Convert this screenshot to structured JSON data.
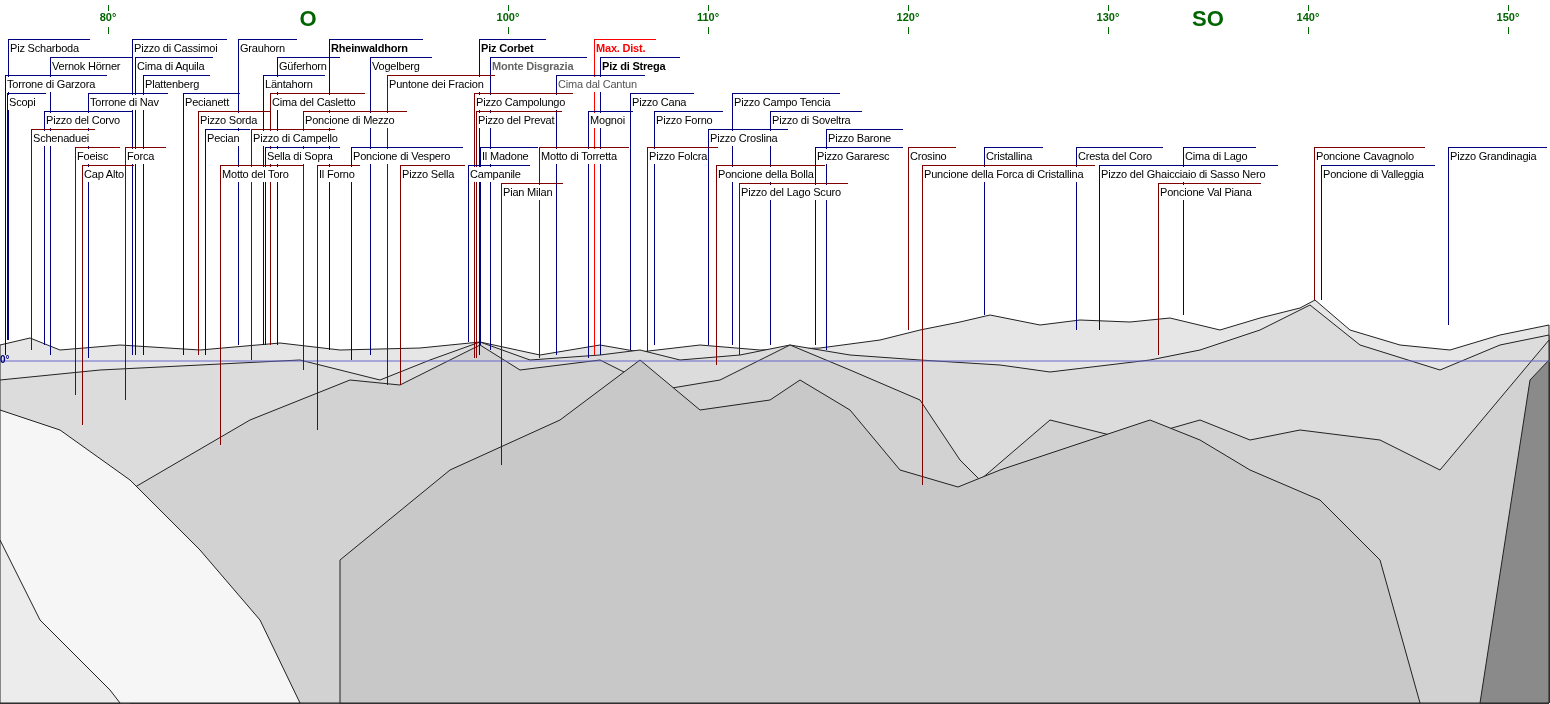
{
  "compass": [
    {
      "text": "80°",
      "kind": "degree"
    },
    {
      "text": "O",
      "kind": "cardinal"
    },
    {
      "text": "100°",
      "kind": "degree"
    },
    {
      "text": "110°",
      "kind": "degree"
    },
    {
      "text": "120°",
      "kind": "degree"
    },
    {
      "text": "130°",
      "kind": "degree"
    },
    {
      "text": "SO",
      "kind": "cardinal"
    },
    {
      "text": "140°",
      "kind": "degree"
    },
    {
      "text": "150°",
      "kind": "degree"
    }
  ],
  "horizon": {
    "label": "0°"
  },
  "labels": [
    {
      "text": "Piz Scharboda",
      "kind": "normal",
      "color": "#000080"
    },
    {
      "text": "Pizzo di Cassimoi",
      "kind": "normal",
      "color": "#000080"
    },
    {
      "text": "Grauhorn",
      "kind": "normal",
      "color": "#000080"
    },
    {
      "text": "Rheinwaldhorn",
      "kind": "bold",
      "color": "#000080"
    },
    {
      "text": "Piz Corbet",
      "kind": "bold",
      "color": "#000080"
    },
    {
      "text": "Max. Dist.",
      "kind": "max",
      "color": "#ff0000"
    },
    {
      "text": "Vernok Hörner",
      "kind": "normal",
      "color": "#000080"
    },
    {
      "text": "Cima di Aquila",
      "kind": "normal",
      "color": "#000080"
    },
    {
      "text": "Güferhorn",
      "kind": "normal",
      "color": "#000080"
    },
    {
      "text": "Vogelberg",
      "kind": "normal",
      "color": "#000080"
    },
    {
      "text": "Monte Disgrazia",
      "kind": "bold-gray",
      "color": "#000080"
    },
    {
      "text": "Piz di Strega",
      "kind": "bold",
      "color": "#000080"
    },
    {
      "text": "Torrone di Garzora",
      "kind": "normal",
      "color": "#000080"
    },
    {
      "text": "Plattenberg",
      "kind": "normal",
      "color": "#000080"
    },
    {
      "text": "Läntahorn",
      "kind": "normal",
      "color": "#000080"
    },
    {
      "text": "Puntone dei Fracion",
      "kind": "normal",
      "color": "#800000"
    },
    {
      "text": "Cima dal Cantun",
      "kind": "gray",
      "color": "#000080"
    },
    {
      "text": "Scopi",
      "kind": "normal",
      "color": "#000080"
    },
    {
      "text": "Torrone di Nav",
      "kind": "normal",
      "color": "#000080"
    },
    {
      "text": "Pecianett",
      "kind": "normal",
      "color": "#000080"
    },
    {
      "text": "Cima del Casletto",
      "kind": "normal",
      "color": "#800000"
    },
    {
      "text": "Pizzo Campolungo",
      "kind": "normal",
      "color": "#800000"
    },
    {
      "text": "Pizzo Cana",
      "kind": "normal",
      "color": "#000080"
    },
    {
      "text": "Pizzo Campo Tencia",
      "kind": "normal",
      "color": "#000080"
    },
    {
      "text": "Pizzo del Corvo",
      "kind": "normal",
      "color": "#000080"
    },
    {
      "text": "Pizzo Sorda",
      "kind": "normal",
      "color": "#800000"
    },
    {
      "text": "Poncione di Mezzo",
      "kind": "normal",
      "color": "#800000"
    },
    {
      "text": "Pizzo del Prevat",
      "kind": "normal",
      "color": "#800000"
    },
    {
      "text": "Mognoi",
      "kind": "normal",
      "color": "#000080"
    },
    {
      "text": "Pizzo Forno",
      "kind": "normal",
      "color": "#000080"
    },
    {
      "text": "Pizzo di Soveltra",
      "kind": "normal",
      "color": "#000080"
    },
    {
      "text": "Schenaduei",
      "kind": "normal",
      "color": "#800000"
    },
    {
      "text": "Pecian",
      "kind": "normal",
      "color": "#000080"
    },
    {
      "text": "Pizzo di Campello",
      "kind": "normal",
      "color": "#800000"
    },
    {
      "text": "Pizzo Croslina",
      "kind": "normal",
      "color": "#000080"
    },
    {
      "text": "Pizzo Barone",
      "kind": "normal",
      "color": "#000080"
    },
    {
      "text": "Foeisc",
      "kind": "normal",
      "color": "#800000"
    },
    {
      "text": "Forca",
      "kind": "normal",
      "color": "#800000"
    },
    {
      "text": "Sella di Sopra",
      "kind": "normal",
      "color": "#000080"
    },
    {
      "text": "Poncione di Vespero",
      "kind": "normal",
      "color": "#000080"
    },
    {
      "text": "Il Madone",
      "kind": "normal",
      "color": "#000080"
    },
    {
      "text": "Motto di Torretta",
      "kind": "normal",
      "color": "#800000"
    },
    {
      "text": "Pizzo Folcra",
      "kind": "normal",
      "color": "#800000"
    },
    {
      "text": "Pizzo Gararesc",
      "kind": "normal",
      "color": "#000080"
    },
    {
      "text": "Crosino",
      "kind": "normal",
      "color": "#800000"
    },
    {
      "text": "Cristallina",
      "kind": "normal",
      "color": "#000080"
    },
    {
      "text": "Cresta del Coro",
      "kind": "normal",
      "color": "#000080"
    },
    {
      "text": "Cima di Lago",
      "kind": "normal",
      "color": "#000080"
    },
    {
      "text": "Poncione Cavagnolo",
      "kind": "normal",
      "color": "#800000"
    },
    {
      "text": "Pizzo Grandinagia",
      "kind": "normal",
      "color": "#000080"
    },
    {
      "text": "Cap Alto",
      "kind": "normal",
      "color": "#800000"
    },
    {
      "text": "Motto del Toro",
      "kind": "normal",
      "color": "#800000"
    },
    {
      "text": "Il Forno",
      "kind": "normal",
      "color": "#800000"
    },
    {
      "text": "Pizzo Sella",
      "kind": "normal",
      "color": "#800000"
    },
    {
      "text": "Campanile",
      "kind": "normal",
      "color": "#000080"
    },
    {
      "text": "Poncione della Bolla",
      "kind": "normal",
      "color": "#800000"
    },
    {
      "text": "Puncione della Forca di Cristallina",
      "kind": "normal",
      "color": "#800000"
    },
    {
      "text": "Pizzo del Ghaicciaio di Sasso Nero",
      "kind": "normal",
      "color": "#000080"
    },
    {
      "text": "Poncione di Valleggia",
      "kind": "normal",
      "color": "#000080"
    },
    {
      "text": "Pian Milan",
      "kind": "normal",
      "color": "#800000"
    },
    {
      "text": "Pizzo del Lago Scuro",
      "kind": "normal",
      "color": "#800000"
    },
    {
      "text": "Poncione Val Piana",
      "kind": "normal",
      "color": "#800000"
    }
  ]
}
